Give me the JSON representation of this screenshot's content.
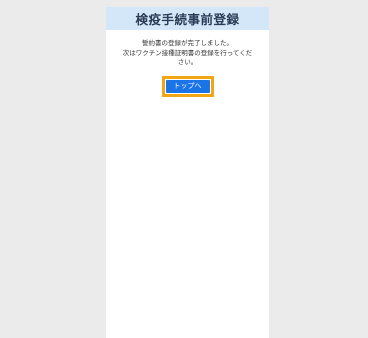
{
  "header": {
    "title": "検疫手続事前登録"
  },
  "message": {
    "line1": "誓約書の登録が完了しました。",
    "line2": "次はワクチン接種証明書の登録を行ってくだ",
    "line3": "さい。"
  },
  "actions": {
    "top_button_label": "トップへ"
  },
  "colors": {
    "header_bg": "#d3e7f8",
    "button_bg": "#1b73e8",
    "highlight": "#f2a615",
    "page_bg": "#ebebeb"
  }
}
